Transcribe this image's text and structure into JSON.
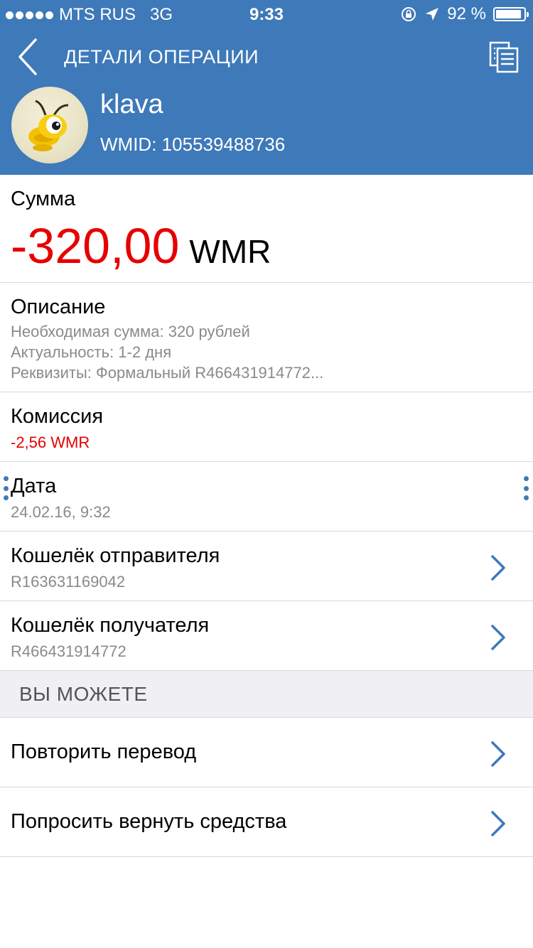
{
  "statusbar": {
    "carrier": "MTS RUS",
    "network": "3G",
    "time": "9:33",
    "battery": "92 %",
    "battery_level": 0.92
  },
  "header": {
    "title": "ДЕТАЛИ ОПЕРАЦИИ",
    "user_name": "klava",
    "wmid": "WMID: 105539488736"
  },
  "amount": {
    "label": "Сумма",
    "value": "-320,00",
    "currency": "WMR"
  },
  "description": {
    "label": "Описание",
    "lines": [
      "Необходимая сумма: 320 рублей",
      "Актуальность: 1-2 дня",
      "Реквизиты: Формальный R466431914772..."
    ]
  },
  "commission": {
    "label": "Комиссия",
    "value": "-2,56 WMR"
  },
  "date": {
    "label": "Дата",
    "value": "24.02.16, 9:32"
  },
  "sender_wallet": {
    "label": "Кошелёк отправителя",
    "value": "R163631169042"
  },
  "recipient_wallet": {
    "label": "Кошелёк получателя",
    "value": "R466431914772"
  },
  "actions": {
    "section_title": "ВЫ МОЖЕТЕ",
    "repeat": "Повторить перевод",
    "refund": "Попросить вернуть средства"
  },
  "colors": {
    "header_bg": "#3e79b9",
    "negative": "#e60000",
    "secondary_text": "#8a8a8a",
    "accent": "#3e79b9"
  }
}
